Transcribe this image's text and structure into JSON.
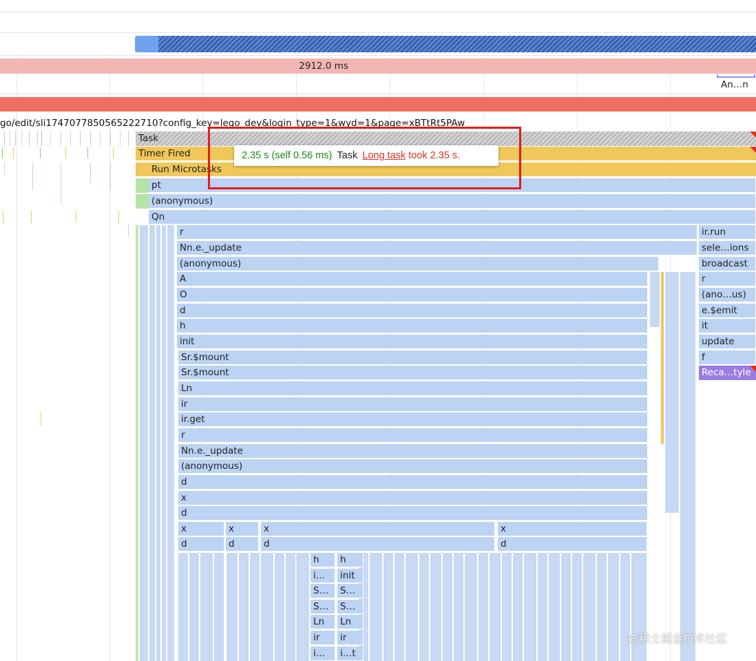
{
  "overview": {
    "duration_label": "2912.0 ms",
    "interaction_label": "An…n"
  },
  "url_text": "go/edit/sli1747077850565222710?config_key=lego_dev&login_type=1&wyd=1&page=xBTtRt5PAw",
  "tooltip": {
    "time": "2.35 s (self 0.56 ms)",
    "name": "Task",
    "warning_link": "Long task",
    "warning_text": "took 2.35 s."
  },
  "flame": {
    "task": "Task",
    "timer_fired": "Timer Fired",
    "run_microtasks": "Run Microtasks",
    "main_stack": [
      "pt",
      "(anonymous)",
      "Qn",
      "r",
      "Nn.e._update",
      "(anonymous)",
      "A",
      "O",
      "d",
      "h",
      "init",
      "Sr.$mount",
      "Sr.$mount",
      "Ln",
      "ir",
      "ir.get",
      "r",
      "Nn.e._update",
      "(anonymous)",
      "d",
      "x",
      "d"
    ],
    "right_stack": [
      "ir.run",
      "sele…ions",
      "broadcast",
      "r",
      "(ano…us)",
      "e.$emit",
      "it",
      "update",
      "f",
      "Reca…tyle"
    ],
    "row_x": [
      "x",
      "x",
      "x",
      "x"
    ],
    "row_d": [
      "d",
      "d",
      "d",
      "d"
    ],
    "deep_col1": [
      "h",
      "i…",
      "S…",
      "S…",
      "Ln",
      "ir",
      "i…"
    ],
    "deep_col2": [
      "h",
      "init",
      "S…",
      "S…",
      "Ln",
      "ir",
      "i…t"
    ]
  },
  "watermark": "@稀土掘金技术社区",
  "colors": {
    "task_red": "#ee6f61",
    "overview_pink": "#f2b7b2",
    "yellow": "#f0c75a",
    "blue": "#bcd3f4",
    "purple": "#9b7ce0",
    "highlight_box": "#e41b1b"
  }
}
